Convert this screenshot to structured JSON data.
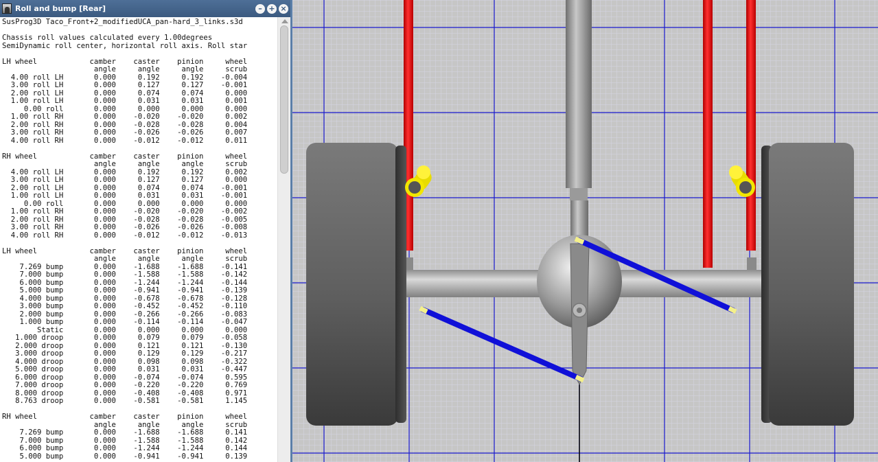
{
  "window": {
    "title": "Roll and bump [Rear]",
    "buttons": {
      "minimize": "–",
      "maximize": "+",
      "close": "×"
    }
  },
  "report": {
    "header": [
      "SusProg3D Taco_Front+2_modifiedUCA_pan-hard_3_links.s3d",
      "",
      "Chassis roll values calculated every 1.00degrees",
      "SemiDynamic roll center, horizontal roll axis. Roll star"
    ],
    "columns": [
      "camber",
      "caster",
      "pinion",
      "wheel"
    ],
    "subcolumns": [
      "angle",
      "angle",
      "angle",
      "scrub"
    ],
    "sections": [
      {
        "title": "LH wheel",
        "rows": [
          [
            "4.00 roll LH",
            "0.000",
            "0.192",
            "0.192",
            "-0.004"
          ],
          [
            "3.00 roll LH",
            "0.000",
            "0.127",
            "0.127",
            "-0.001"
          ],
          [
            "2.00 roll LH",
            "0.000",
            "0.074",
            "0.074",
            "0.000"
          ],
          [
            "1.00 roll LH",
            "0.000",
            "0.031",
            "0.031",
            "0.001"
          ],
          [
            "0.00 roll",
            "0.000",
            "0.000",
            "0.000",
            "0.000"
          ],
          [
            "1.00 roll RH",
            "0.000",
            "-0.020",
            "-0.020",
            "0.002"
          ],
          [
            "2.00 roll RH",
            "0.000",
            "-0.028",
            "-0.028",
            "0.004"
          ],
          [
            "3.00 roll RH",
            "0.000",
            "-0.026",
            "-0.026",
            "0.007"
          ],
          [
            "4.00 roll RH",
            "0.000",
            "-0.012",
            "-0.012",
            "0.011"
          ]
        ]
      },
      {
        "title": "RH wheel",
        "rows": [
          [
            "4.00 roll LH",
            "0.000",
            "0.192",
            "0.192",
            "0.002"
          ],
          [
            "3.00 roll LH",
            "0.000",
            "0.127",
            "0.127",
            "0.000"
          ],
          [
            "2.00 roll LH",
            "0.000",
            "0.074",
            "0.074",
            "-0.001"
          ],
          [
            "1.00 roll LH",
            "0.000",
            "0.031",
            "0.031",
            "-0.001"
          ],
          [
            "0.00 roll",
            "0.000",
            "0.000",
            "0.000",
            "0.000"
          ],
          [
            "1.00 roll RH",
            "0.000",
            "-0.020",
            "-0.020",
            "-0.002"
          ],
          [
            "2.00 roll RH",
            "0.000",
            "-0.028",
            "-0.028",
            "-0.005"
          ],
          [
            "3.00 roll RH",
            "0.000",
            "-0.026",
            "-0.026",
            "-0.008"
          ],
          [
            "4.00 roll RH",
            "0.000",
            "-0.012",
            "-0.012",
            "-0.013"
          ]
        ]
      },
      {
        "title": "LH wheel",
        "rows": [
          [
            "7.269 bump",
            "0.000",
            "-1.688",
            "-1.688",
            "-0.141"
          ],
          [
            "7.000 bump",
            "0.000",
            "-1.588",
            "-1.588",
            "-0.142"
          ],
          [
            "6.000 bump",
            "0.000",
            "-1.244",
            "-1.244",
            "-0.144"
          ],
          [
            "5.000 bump",
            "0.000",
            "-0.941",
            "-0.941",
            "-0.139"
          ],
          [
            "4.000 bump",
            "0.000",
            "-0.678",
            "-0.678",
            "-0.128"
          ],
          [
            "3.000 bump",
            "0.000",
            "-0.452",
            "-0.452",
            "-0.110"
          ],
          [
            "2.000 bump",
            "0.000",
            "-0.266",
            "-0.266",
            "-0.083"
          ],
          [
            "1.000 bump",
            "0.000",
            "-0.114",
            "-0.114",
            "-0.047"
          ],
          [
            "Static",
            "0.000",
            "0.000",
            "0.000",
            "0.000"
          ],
          [
            "1.000 droop",
            "0.000",
            "0.079",
            "0.079",
            "-0.058"
          ],
          [
            "2.000 droop",
            "0.000",
            "0.121",
            "0.121",
            "-0.130"
          ],
          [
            "3.000 droop",
            "0.000",
            "0.129",
            "0.129",
            "-0.217"
          ],
          [
            "4.000 droop",
            "0.000",
            "0.098",
            "0.098",
            "-0.322"
          ],
          [
            "5.000 droop",
            "0.000",
            "0.031",
            "0.031",
            "-0.447"
          ],
          [
            "6.000 droop",
            "0.000",
            "-0.074",
            "-0.074",
            "0.595"
          ],
          [
            "7.000 droop",
            "0.000",
            "-0.220",
            "-0.220",
            "0.769"
          ],
          [
            "8.000 droop",
            "0.000",
            "-0.408",
            "-0.408",
            "0.971"
          ],
          [
            "8.763 droop",
            "0.000",
            "-0.581",
            "-0.581",
            "1.145"
          ]
        ]
      },
      {
        "title": "RH wheel",
        "rows": [
          [
            "7.269 bump",
            "0.000",
            "-1.688",
            "-1.688",
            "0.141"
          ],
          [
            "7.000 bump",
            "0.000",
            "-1.588",
            "-1.588",
            "0.142"
          ],
          [
            "6.000 bump",
            "0.000",
            "-1.244",
            "-1.244",
            "0.144"
          ],
          [
            "5.000 bump",
            "0.000",
            "-0.941",
            "-0.941",
            "0.139"
          ]
        ]
      }
    ]
  },
  "viewport": {
    "background": "#c7c7c7",
    "grid_minor_color": "#d8d8e6",
    "grid_major_color": "#1b1bd0",
    "colors": {
      "shock": "#ff1a1a",
      "link": "#1010d8",
      "link_end": "#f4f08a",
      "bushing": "#f2e600",
      "tire_dark": "#333333",
      "axle": "#b0b0b0"
    }
  }
}
